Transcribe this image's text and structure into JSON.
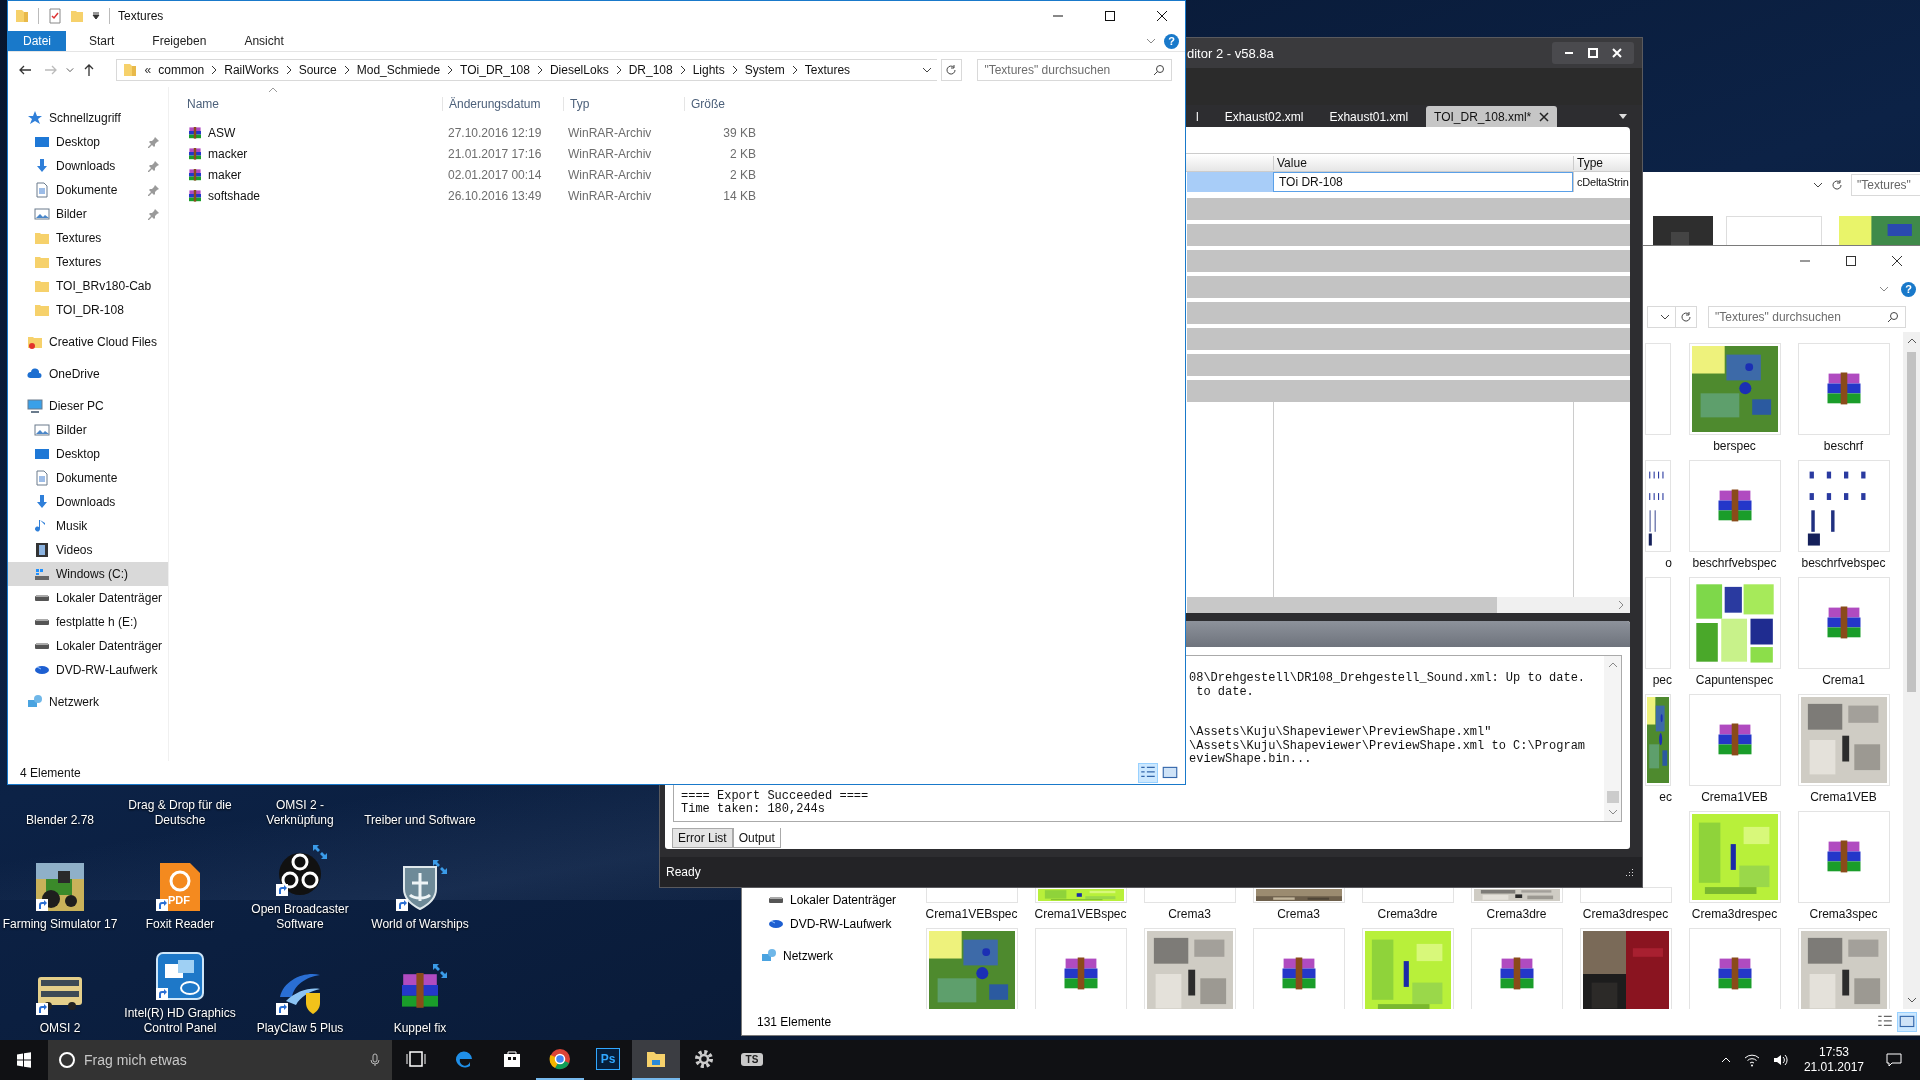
{
  "explorer": {
    "title": "Textures",
    "ribbon_tabs": [
      {
        "label": "Datei",
        "selected": true
      },
      {
        "label": "Start",
        "selected": false
      },
      {
        "label": "Freigeben",
        "selected": false
      },
      {
        "label": "Ansicht",
        "selected": false
      }
    ],
    "help": "?",
    "path_overflow": "«",
    "path": [
      "common",
      "RailWorks",
      "Source",
      "Mod_Schmiede",
      "TOi_DR_108",
      "DieselLoks",
      "DR_108",
      "Lights",
      "System",
      "Textures"
    ],
    "search": {
      "placeholder": "\"Textures\" durchsuchen"
    },
    "nav": [
      {
        "label": "Schnellzugriff",
        "kind": "star",
        "selected": false,
        "children": [
          {
            "label": "Desktop",
            "kind": "desktop",
            "pinned": true,
            "selected": false
          },
          {
            "label": "Downloads",
            "kind": "download",
            "pinned": true,
            "selected": false
          },
          {
            "label": "Dokumente",
            "kind": "document",
            "pinned": true,
            "selected": false
          },
          {
            "label": "Bilder",
            "kind": "pictures",
            "pinned": true,
            "selected": false
          },
          {
            "label": "Textures",
            "kind": "folder",
            "pinned": false,
            "selected": false
          },
          {
            "label": "Textures",
            "kind": "folder",
            "pinned": false,
            "selected": false
          },
          {
            "label": "TOI_BRv180-Cab",
            "kind": "folder",
            "pinned": false,
            "selected": false
          },
          {
            "label": "TOI_DR-108",
            "kind": "folder",
            "pinned": false,
            "selected": false
          }
        ]
      },
      {
        "label": "Creative Cloud Files",
        "kind": "cc",
        "selected": false
      },
      {
        "label": "OneDrive",
        "kind": "cloud",
        "selected": false
      },
      {
        "label": "Dieser PC",
        "kind": "pc",
        "selected": false,
        "children": [
          {
            "label": "Bilder",
            "kind": "pictures",
            "pinned": false,
            "selected": false
          },
          {
            "label": "Desktop",
            "kind": "desktop",
            "pinned": false,
            "selected": false
          },
          {
            "label": "Dokumente",
            "kind": "document",
            "pinned": false,
            "selected": false
          },
          {
            "label": "Downloads",
            "kind": "download",
            "pinned": false,
            "selected": false
          },
          {
            "label": "Musik",
            "kind": "music",
            "pinned": false,
            "selected": false
          },
          {
            "label": "Videos",
            "kind": "video",
            "pinned": false,
            "selected": false
          },
          {
            "label": "Windows (C:)",
            "kind": "windows-drive",
            "pinned": false,
            "selected": true
          },
          {
            "label": "Lokaler Datenträger",
            "kind": "drive",
            "pinned": false,
            "selected": false
          },
          {
            "label": "festplatte h (E:)",
            "kind": "drive",
            "pinned": false,
            "selected": false
          },
          {
            "label": "Lokaler Datenträger",
            "kind": "drive",
            "pinned": false,
            "selected": false
          },
          {
            "label": "DVD-RW-Laufwerk",
            "kind": "dvd",
            "pinned": false,
            "selected": false
          }
        ]
      },
      {
        "label": "Netzwerk",
        "kind": "network",
        "selected": false
      }
    ],
    "columns": [
      "Name",
      "Änderungsdatum",
      "Typ",
      "Größe"
    ],
    "files": [
      {
        "name": "ASW",
        "date": "27.10.2016 12:19",
        "type": "WinRAR-Archiv",
        "size": "39 KB"
      },
      {
        "name": "macker",
        "date": "21.01.2017 17:16",
        "type": "WinRAR-Archiv",
        "size": "2 KB"
      },
      {
        "name": "maker",
        "date": "02.01.2017 00:14",
        "type": "WinRAR-Archiv",
        "size": "2 KB"
      },
      {
        "name": "softshade",
        "date": "26.10.2016 13:49",
        "type": "WinRAR-Archiv",
        "size": "14 KB"
      }
    ],
    "status": "4 Elemente"
  },
  "editor": {
    "title": "ditor 2 - v58.8a",
    "tabs": [
      {
        "label": "l",
        "selected": false
      },
      {
        "label": "Exhaust02.xml",
        "selected": false
      },
      {
        "label": "Exhaust01.xml",
        "selected": false
      },
      {
        "label": "TOI_DR_108.xml*",
        "selected": true
      }
    ],
    "grid": {
      "columns": [
        "Value",
        "Type"
      ],
      "rows": [
        {
          "value": "TOi DR-108",
          "type": "cDeltaStrin",
          "selected": true
        }
      ]
    },
    "output": {
      "upper_blocks": [
        [
          "08\\Drehgestell\\DR108_Drehgestell_Sound.xml: Up to date.",
          " to date."
        ],
        [
          "\\Assets\\Kuju\\Shapeviewer\\PreviewShape.xml\"",
          "\\Assets\\Kuju\\Shapeviewer\\PreviewShape.xml to C:\\Program",
          "eviewShape.bin..."
        ]
      ],
      "lower_lines": [
        "==== Export Succeeded ====",
        "Time taken: 180,244s"
      ],
      "tabs": [
        {
          "label": "Error List",
          "selected": false
        },
        {
          "label": "Output",
          "selected": true
        }
      ]
    },
    "status": "Ready"
  },
  "third_window": {
    "search": {
      "placeholder": "\"Textures\""
    }
  },
  "back_explorer": {
    "help": "?",
    "search": {
      "placeholder": "\"Textures\" durchsuchen"
    },
    "nav": [
      {
        "label": "Lokaler Datenträger",
        "kind": "drive"
      },
      {
        "label": "DVD-RW-Laufwerk",
        "kind": "dvd"
      },
      {
        "label": "Netzwerk",
        "kind": "network"
      }
    ],
    "thumb_rows": [
      [
        {
          "kind": "blank"
        },
        {
          "kind": "green-texture",
          "label": "berspec",
          "cut": false
        },
        {
          "kind": "archive",
          "label": "beschrf",
          "cut": false
        }
      ],
      [
        {
          "kind": "dots-texture",
          "label": "o",
          "cut": true
        },
        {
          "kind": "archive",
          "label": "beschrfvebspec",
          "cut": false
        },
        {
          "kind": "dots-texture",
          "label": "beschrfvebspec",
          "cut": false
        }
      ],
      [
        {
          "kind": "blank",
          "label": "pec",
          "cut": true
        },
        {
          "kind": "mosaic-texture",
          "label": "Capuntenspec",
          "cut": false
        },
        {
          "kind": "archive",
          "label": "Crema1",
          "cut": false
        }
      ],
      [
        {
          "kind": "green-texture",
          "label": "ec",
          "cut": true
        },
        {
          "kind": "archive",
          "label": "Crema1VEB",
          "cut": false
        },
        {
          "kind": "gray-texture",
          "label": "Crema1VEB",
          "cut": false
        }
      ],
      [
        {
          "kind": "blank",
          "label": "Crema1VEBspec",
          "cut": false
        },
        {
          "kind": "lime-texture",
          "label": "Crema1VEBspec",
          "cut": false
        },
        {
          "kind": "blank",
          "label": "Crema3",
          "cut": false
        },
        {
          "kind": "brown-texture",
          "label": "Crema3",
          "cut": false
        },
        {
          "kind": "blank",
          "label": "Crema3dre",
          "cut": false
        },
        {
          "kind": "gray-texture",
          "label": "Crema3dre",
          "cut": false
        },
        {
          "kind": "blank",
          "label": "Crema3drespec",
          "cut": false
        },
        {
          "kind": "lime-texture",
          "label": "Crema3drespec",
          "cut": false
        },
        {
          "kind": "archive",
          "label": "Crema3spec",
          "cut": false
        }
      ],
      [
        {
          "kind": "green-texture"
        },
        {
          "kind": "archive"
        },
        {
          "kind": "gray-texture"
        },
        {
          "kind": "archive"
        },
        {
          "kind": "lime-texture"
        },
        {
          "kind": "archive"
        },
        {
          "kind": "red-texture"
        },
        {
          "kind": "archive"
        },
        {
          "kind": "gray-texture"
        }
      ]
    ],
    "status": "131 Elemente"
  },
  "desktop_icons": [
    {
      "label_lines": [
        "Blender 2.78"
      ],
      "kind": "hidden"
    },
    {
      "label_lines": [
        "Drag & Drop für die",
        "Deutsche"
      ],
      "kind": "hidden"
    },
    {
      "label_lines": [
        "OMSI 2 -",
        "Verknüpfung"
      ],
      "kind": "hidden"
    },
    {
      "label_lines": [
        "Treiber und Software"
      ],
      "kind": "hidden"
    },
    {
      "label_lines": [
        "Farming Simulator 17"
      ],
      "kind": "tractor",
      "shortcut": true,
      "sync_badge": false
    },
    {
      "label_lines": [
        "Foxit Reader"
      ],
      "kind": "pdf",
      "badge": "PDF",
      "shortcut": true,
      "sync_badge": false
    },
    {
      "label_lines": [
        "Open Broadcaster",
        "Software"
      ],
      "kind": "swirl",
      "shortcut": true,
      "sync_badge": true
    },
    {
      "label_lines": [
        "World of Warships"
      ],
      "kind": "shield",
      "shortcut": true,
      "sync_badge": true
    },
    {
      "label_lines": [
        "OMSI 2"
      ],
      "kind": "bus",
      "shortcut": true,
      "sync_badge": false
    },
    {
      "label_lines": [
        "Intel(R) HD Graphics",
        "Control Panel"
      ],
      "kind": "panel",
      "shortcut": true,
      "sync_badge": false
    },
    {
      "label_lines": [
        "PlayClaw 5 Plus"
      ],
      "kind": "swoosh",
      "shortcut": true,
      "sync_badge": false
    },
    {
      "label_lines": [
        "Kuppel fix"
      ],
      "kind": "archive",
      "shortcut": false,
      "sync_badge": true
    }
  ],
  "taskbar": {
    "search": {
      "placeholder": "Frag mich etwas"
    },
    "items": [
      {
        "kind": "task-view",
        "running": false,
        "active": false
      },
      {
        "kind": "edge",
        "running": false,
        "active": false
      },
      {
        "kind": "store",
        "running": false,
        "active": false
      },
      {
        "kind": "chrome",
        "running": true,
        "active": false
      },
      {
        "kind": "photoshop",
        "glyph": "Ps",
        "running": false,
        "active": false
      },
      {
        "kind": "explorer",
        "running": true,
        "active": true
      },
      {
        "kind": "gear",
        "running": false,
        "active": false
      },
      {
        "kind": "ts",
        "glyph": "TS",
        "running": false,
        "active": false
      }
    ],
    "time": "17:53",
    "date": "21.01.2017"
  }
}
